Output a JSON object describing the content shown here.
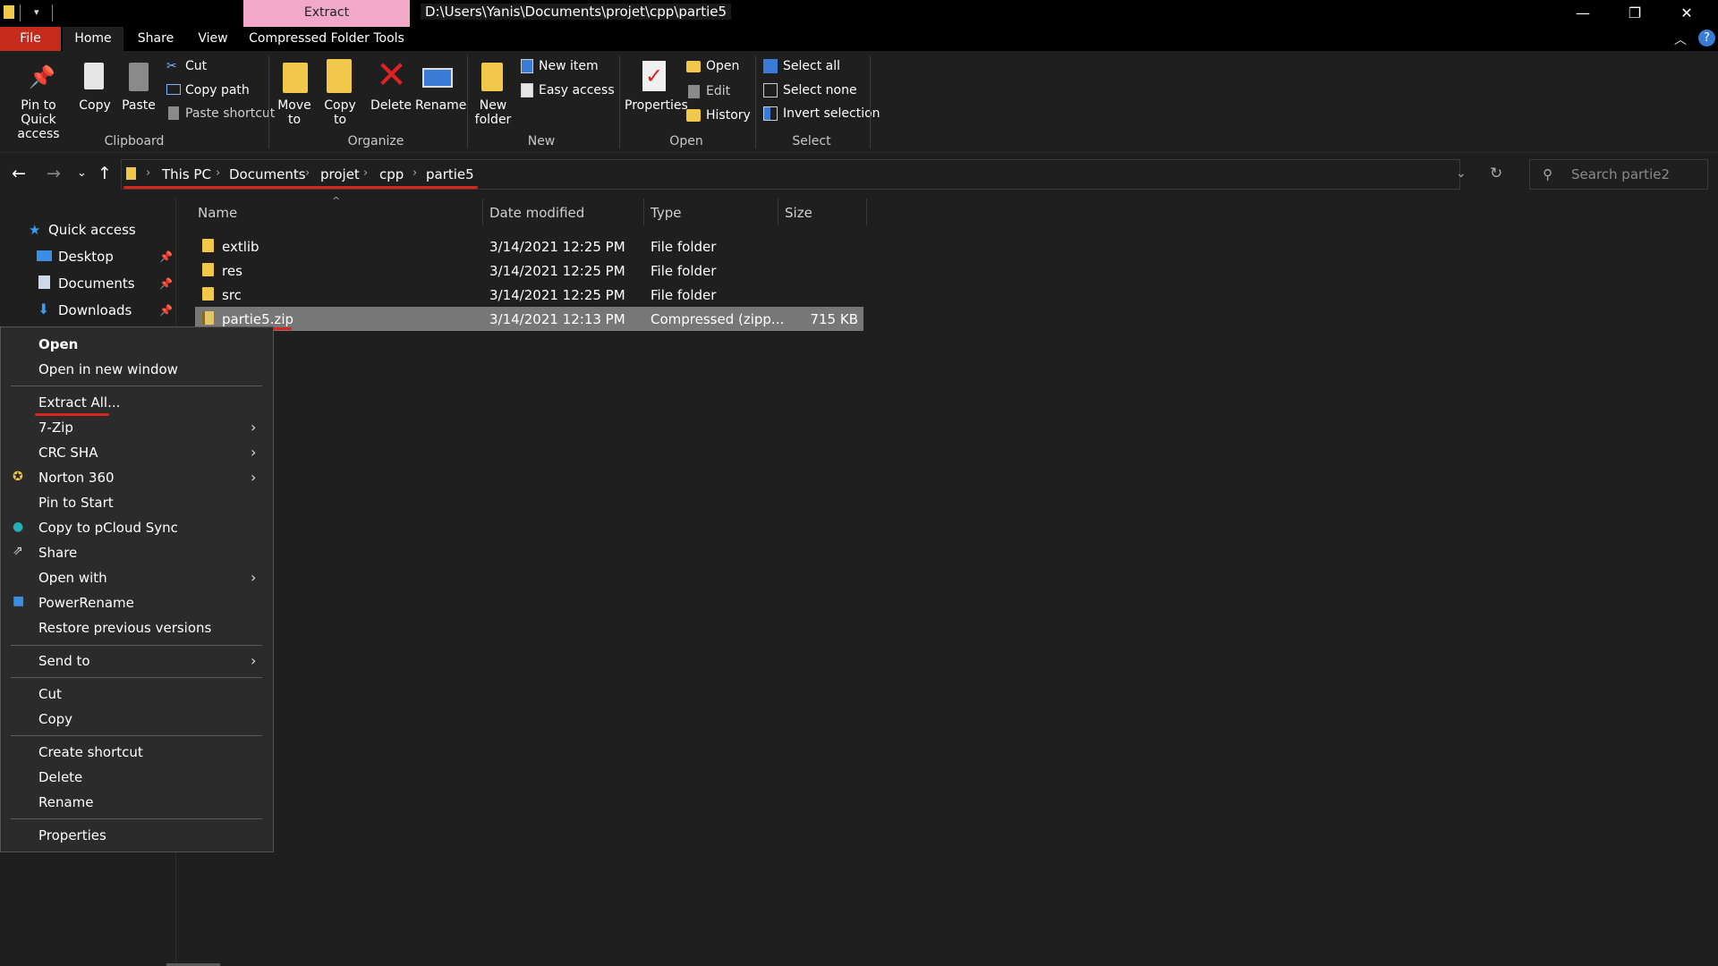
{
  "titlebar": {
    "context_tab": "Extract",
    "path": "D:\\Users\\Yanis\\Documents\\projet\\cpp\\partie5",
    "minimize": "—",
    "restore": "❐",
    "close": "✕"
  },
  "tabs": {
    "file": "File",
    "home": "Home",
    "share": "Share",
    "view": "View",
    "compressed": "Compressed Folder Tools"
  },
  "ribbon": {
    "clipboard": {
      "pin": "Pin to Quick access",
      "copy": "Copy",
      "paste": "Paste",
      "cut": "Cut",
      "copy_path": "Copy path",
      "paste_shortcut": "Paste shortcut",
      "group": "Clipboard"
    },
    "organize": {
      "move_to": "Move to",
      "copy_to": "Copy to",
      "delete": "Delete",
      "rename": "Rename",
      "group": "Organize"
    },
    "new": {
      "new_folder": "New folder",
      "new_item": "New item",
      "easy_access": "Easy access",
      "group": "New"
    },
    "open": {
      "properties": "Properties",
      "open": "Open",
      "edit": "Edit",
      "history": "History",
      "group": "Open"
    },
    "select": {
      "select_all": "Select all",
      "select_none": "Select none",
      "invert": "Invert selection",
      "group": "Select"
    }
  },
  "address": {
    "crumbs": [
      "This PC",
      "Documents",
      "projet",
      "cpp",
      "partie5"
    ],
    "search_placeholder": "Search partie2"
  },
  "nav": {
    "quick_access": "Quick access",
    "desktop": "Desktop",
    "documents": "Documents",
    "downloads": "Downloads"
  },
  "columns": {
    "name": "Name",
    "date": "Date modified",
    "type": "Type",
    "size": "Size"
  },
  "files": [
    {
      "name": "extlib",
      "date": "3/14/2021 12:25 PM",
      "type": "File folder",
      "size": ""
    },
    {
      "name": "res",
      "date": "3/14/2021 12:25 PM",
      "type": "File folder",
      "size": ""
    },
    {
      "name": "src",
      "date": "3/14/2021 12:25 PM",
      "type": "File folder",
      "size": ""
    },
    {
      "name": "partie5.zip",
      "date": "3/14/2021 12:13 PM",
      "type": "Compressed (zipp...",
      "size": "715 KB"
    }
  ],
  "context_menu": {
    "open": "Open",
    "open_new_window": "Open in new window",
    "extract_all": "Extract All...",
    "seven_zip": "7-Zip",
    "crc_sha": "CRC SHA",
    "norton": "Norton 360",
    "pin_start": "Pin to Start",
    "pcloud": "Copy to pCloud Sync",
    "share": "Share",
    "open_with": "Open with",
    "powerrename": "PowerRename",
    "restore": "Restore previous versions",
    "send_to": "Send to",
    "cut": "Cut",
    "copy": "Copy",
    "create_shortcut": "Create shortcut",
    "delete": "Delete",
    "rename": "Rename",
    "properties": "Properties"
  },
  "colors": {
    "file_tab": "#c42b1c",
    "context_tab": "#f2a8c9",
    "annotation": "#d9261c",
    "folder": "#f2c84b"
  }
}
